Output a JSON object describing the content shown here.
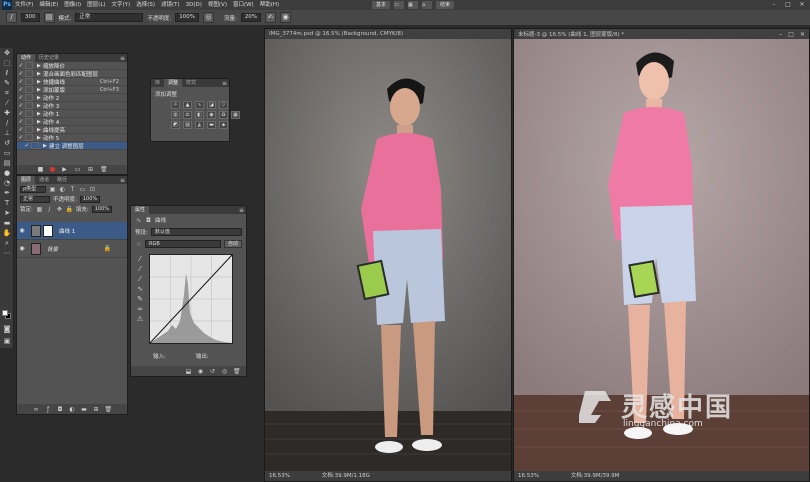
{
  "menubar": {
    "logo": "Ps",
    "items": [
      "文件(F)",
      "编辑(E)",
      "图像(I)",
      "图层(L)",
      "文字(Y)",
      "选择(S)",
      "滤镜(T)",
      "3D(D)",
      "视图(V)",
      "窗口(W)",
      "帮助(H)"
    ],
    "workspace_buttons": [
      "基本",
      "",
      "",
      "",
      "结束"
    ],
    "window_controls": [
      "–",
      "□",
      "✕"
    ]
  },
  "options_bar": {
    "brush_size": "300",
    "mode_label": "模式:",
    "mode_value": "正常",
    "opacity_label": "不透明度:",
    "opacity_value": "100%",
    "flow_label": "流量:",
    "flow_value": "20%"
  },
  "actions_panel": {
    "tabs": [
      "动作",
      "历史记录"
    ],
    "rows": [
      {
        "name": "缩放降价",
        "key": "",
        "selected": false
      },
      {
        "name": "混合画面色彩匹配图层",
        "key": "",
        "selected": false
      },
      {
        "name": "快捷曲线",
        "key": "Ctrl+F2",
        "selected": false
      },
      {
        "name": "添加蒙版",
        "key": "Ctrl+F3",
        "selected": false
      },
      {
        "name": "动作 2",
        "key": "",
        "selected": false
      },
      {
        "name": "动作 3",
        "key": "",
        "selected": false
      },
      {
        "name": "动作 1",
        "key": "",
        "selected": false
      },
      {
        "name": "动作 4",
        "key": "",
        "selected": false
      },
      {
        "name": "曲线提亮",
        "key": "",
        "selected": false
      },
      {
        "name": "动作 5",
        "key": "",
        "selected": false
      },
      {
        "name": "建立 调整图层",
        "key": "",
        "selected": true
      }
    ]
  },
  "adjust_panel": {
    "tabs": [
      "库",
      "调整",
      "样式"
    ],
    "title": "添加调整"
  },
  "layers_panel": {
    "tabs": [
      "图层",
      "通道",
      "路径"
    ],
    "filter_value": "ρ类型",
    "blend_value": "正常",
    "opacity_label": "不透明度:",
    "opacity_value": "100%",
    "lock_label": "锁定:",
    "fill_label": "填充:",
    "fill_value": "100%",
    "layers": [
      {
        "name": "曲线 1",
        "selected": true
      },
      {
        "name": "背景",
        "selected": false
      }
    ]
  },
  "properties_panel": {
    "tabs": [
      "属性"
    ],
    "title": "曲线",
    "preset_label": "预设:",
    "preset_value": "默认值",
    "channel_value": "RGB",
    "auto_label": "自动",
    "input_label": "输入:",
    "output_label": "输出:"
  },
  "documents": {
    "left": {
      "title": "IMG_3774m.psd @ 16.5% (Background, CMYK/8)",
      "zoom": "16.53%",
      "doc_info": "文档:39.9M/1.18G"
    },
    "right": {
      "title": "未标题-3 @ 16.5% (曲线 1, 图层蒙版/8) *",
      "zoom": "16.53%",
      "doc_info": "文档:39.9M/39.9M"
    }
  },
  "watermark": {
    "cn": "灵感中国",
    "en": "lingganchina.com"
  },
  "colors": {
    "selection": "#3b5a86",
    "panel": "#535353",
    "sweater": "#e8709a"
  }
}
